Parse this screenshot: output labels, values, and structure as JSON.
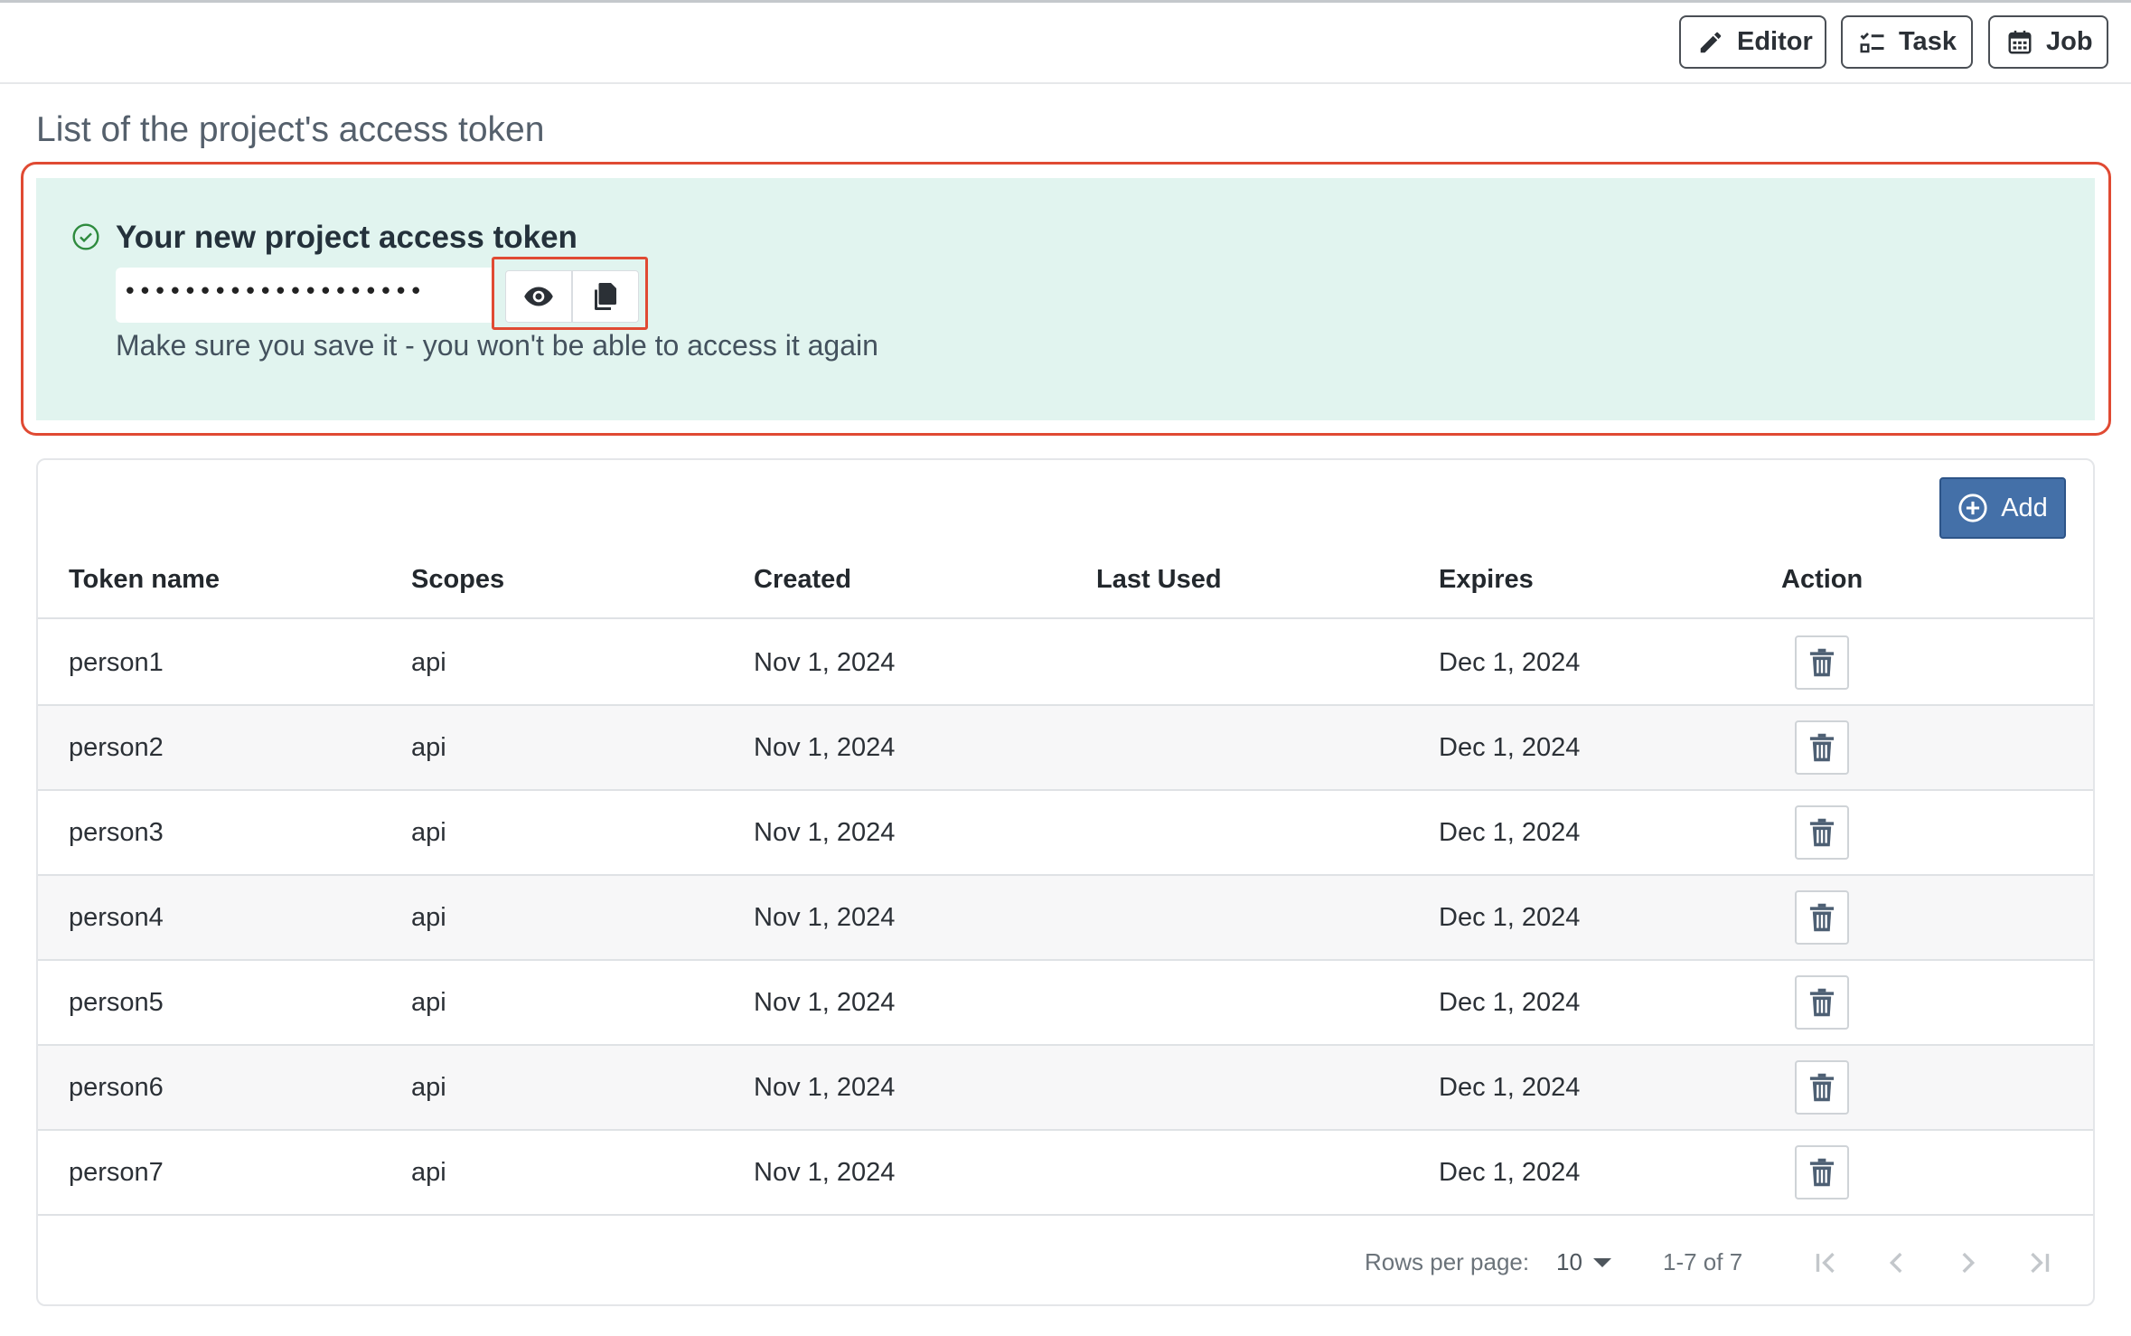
{
  "toolbar": {
    "editor_label": "Editor",
    "task_label": "Task",
    "job_label": "Job"
  },
  "page_title": "List of the project's access token",
  "alert": {
    "title": "Your new project access token",
    "token_masked": "••••••••••••••••••••",
    "note": "Make sure you save it - you won't be able to access it again",
    "accent_color": "#e04a33",
    "background_color": "#e1f4ef"
  },
  "table": {
    "add_label": "Add",
    "columns": [
      "Token name",
      "Scopes",
      "Created",
      "Last Used",
      "Expires",
      "Action"
    ],
    "rows": [
      {
        "name": "person1",
        "scopes": "api",
        "created": "Nov 1, 2024",
        "last_used": "",
        "expires": "Dec 1, 2024"
      },
      {
        "name": "person2",
        "scopes": "api",
        "created": "Nov 1, 2024",
        "last_used": "",
        "expires": "Dec 1, 2024"
      },
      {
        "name": "person3",
        "scopes": "api",
        "created": "Nov 1, 2024",
        "last_used": "",
        "expires": "Dec 1, 2024"
      },
      {
        "name": "person4",
        "scopes": "api",
        "created": "Nov 1, 2024",
        "last_used": "",
        "expires": "Dec 1, 2024"
      },
      {
        "name": "person5",
        "scopes": "api",
        "created": "Nov 1, 2024",
        "last_used": "",
        "expires": "Dec 1, 2024"
      },
      {
        "name": "person6",
        "scopes": "api",
        "created": "Nov 1, 2024",
        "last_used": "",
        "expires": "Dec 1, 2024"
      },
      {
        "name": "person7",
        "scopes": "api",
        "created": "Nov 1, 2024",
        "last_used": "",
        "expires": "Dec 1, 2024"
      }
    ]
  },
  "pagination": {
    "rows_per_page_label": "Rows per page:",
    "rows_per_page_value": "10",
    "range_text": "1-7 of 7"
  },
  "icons": {
    "editor": "pencil-icon",
    "task": "checklist-icon",
    "job": "calendar-icon",
    "check": "check-circle-icon",
    "reveal": "eye-icon",
    "copy": "copy-icon",
    "add": "plus-circle-icon",
    "delete": "trash-icon"
  },
  "colors": {
    "primary_button": "#4470a8",
    "highlight_border": "#e04a33"
  }
}
